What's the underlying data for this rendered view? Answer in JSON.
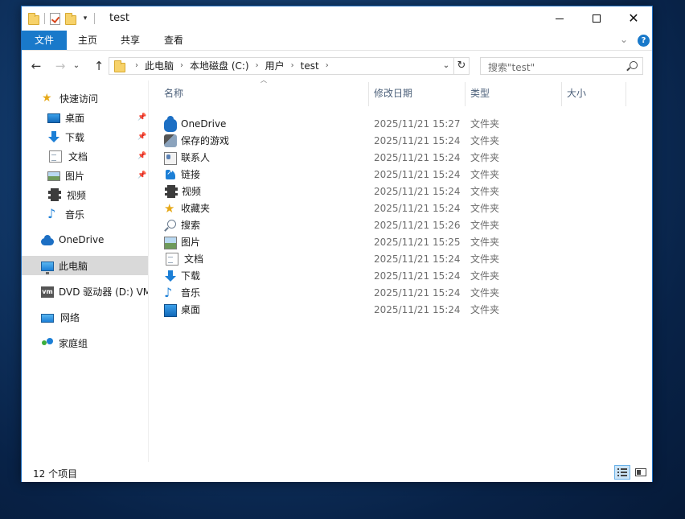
{
  "window": {
    "title": "test"
  },
  "ribbon": {
    "tabs": [
      "文件",
      "主页",
      "共享",
      "查看"
    ]
  },
  "address": {
    "crumbs": [
      "此电脑",
      "本地磁盘 (C:)",
      "用户",
      "test"
    ]
  },
  "search": {
    "placeholder": "搜索\"test\""
  },
  "sidebar": {
    "items": [
      {
        "label": "快速访问",
        "icon": "quick-access-star-icon"
      },
      {
        "label": "桌面",
        "icon": "desktop-icon",
        "pinned": true
      },
      {
        "label": "下载",
        "icon": "downloads-icon",
        "pinned": true
      },
      {
        "label": "文档",
        "icon": "documents-icon",
        "pinned": true
      },
      {
        "label": "图片",
        "icon": "pictures-icon",
        "pinned": true
      },
      {
        "label": "视频",
        "icon": "videos-icon"
      },
      {
        "label": "音乐",
        "icon": "music-icon"
      },
      {
        "label": "OneDrive",
        "icon": "onedrive-icon"
      },
      {
        "label": "此电脑",
        "icon": "this-pc-icon",
        "selected": true
      },
      {
        "label": "DVD 驱动器 (D:) VM",
        "icon": "dvd-drive-icon"
      },
      {
        "label": "网络",
        "icon": "network-icon"
      },
      {
        "label": "家庭组",
        "icon": "homegroup-icon"
      }
    ]
  },
  "columns": [
    "名称",
    "修改日期",
    "类型",
    "大小"
  ],
  "files": [
    {
      "name": "OneDrive",
      "date": "2025/11/21 15:27",
      "type": "文件夹",
      "icon": "onedrive-icon"
    },
    {
      "name": "保存的游戏",
      "date": "2025/11/21 15:24",
      "type": "文件夹",
      "icon": "saved-games-icon"
    },
    {
      "name": "联系人",
      "date": "2025/11/21 15:24",
      "type": "文件夹",
      "icon": "contacts-icon"
    },
    {
      "name": "链接",
      "date": "2025/11/21 15:24",
      "type": "文件夹",
      "icon": "links-icon"
    },
    {
      "name": "视频",
      "date": "2025/11/21 15:24",
      "type": "文件夹",
      "icon": "videos-icon"
    },
    {
      "name": "收藏夹",
      "date": "2025/11/21 15:24",
      "type": "文件夹",
      "icon": "favorites-icon"
    },
    {
      "name": "搜索",
      "date": "2025/11/21 15:26",
      "type": "文件夹",
      "icon": "searches-icon"
    },
    {
      "name": "图片",
      "date": "2025/11/21 15:25",
      "type": "文件夹",
      "icon": "pictures-icon"
    },
    {
      "name": "文档",
      "date": "2025/11/21 15:24",
      "type": "文件夹",
      "icon": "documents-icon"
    },
    {
      "name": "下载",
      "date": "2025/11/21 15:24",
      "type": "文件夹",
      "icon": "downloads-icon"
    },
    {
      "name": "音乐",
      "date": "2025/11/21 15:24",
      "type": "文件夹",
      "icon": "music-icon"
    },
    {
      "name": "桌面",
      "date": "2025/11/21 15:24",
      "type": "文件夹",
      "icon": "desktop-icon"
    }
  ],
  "status": {
    "item_count": "12 个项目"
  },
  "colors": {
    "accent": "#1979ca",
    "selection": "#d9d9d9",
    "folder": "#f7d26a"
  }
}
